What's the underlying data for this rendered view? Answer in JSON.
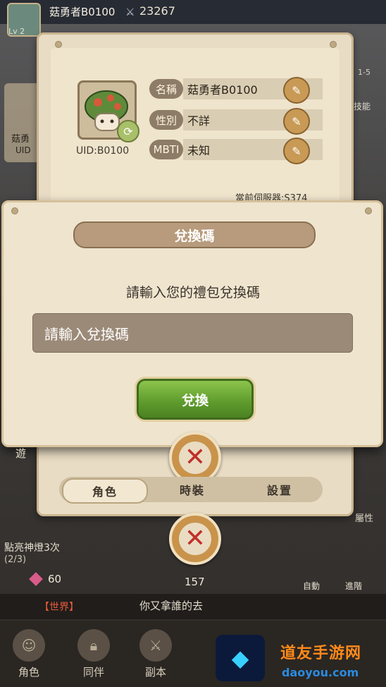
{
  "header": {
    "player_name": "菇勇者B0100",
    "power": "23267",
    "level": "Lv 2"
  },
  "side": {
    "name": "菇勇",
    "uid": "UID",
    "left_button": "遊",
    "right_level": "1-5",
    "right_skill": "技能",
    "right_attr": "屬性"
  },
  "profile": {
    "uid": "UID:B0100",
    "fields": [
      {
        "label": "名稱",
        "value": "菇勇者B0100"
      },
      {
        "label": "性別",
        "value": "不詳"
      },
      {
        "label": "MBTI",
        "value": "未知"
      }
    ],
    "server": "當前伺服器:S374",
    "tabs": [
      {
        "label": "角色",
        "active": true
      },
      {
        "label": "時裝",
        "active": false
      },
      {
        "label": "設置",
        "active": false
      }
    ]
  },
  "dialog": {
    "title": "兌換碼",
    "prompt": "請輸入您的禮包兌換碼",
    "input_placeholder": "請輸入兌換碼",
    "redeem_label": "兌換"
  },
  "bottom": {
    "quest_title": "點亮神燈3次",
    "quest_progress": "(2/3)",
    "gems": "60",
    "pedestal_count": "157",
    "auto_label": "自動",
    "advance_label": "進階",
    "chat_channel": "【世界】",
    "chat_message": "你又拿誰的去",
    "nav": [
      "角色",
      "同伴",
      "副本"
    ]
  },
  "watermark": {
    "text": "道友手游网",
    "url": "daoyou.com"
  },
  "colors": {
    "panel": "#efe5cf",
    "accent_green": "#6aa836",
    "close_red": "#c0302a"
  }
}
